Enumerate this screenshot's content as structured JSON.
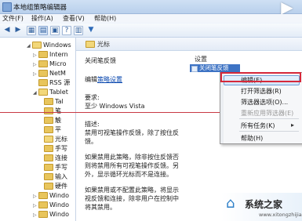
{
  "window": {
    "title": "本地组策略编辑器"
  },
  "menubar": {
    "items": [
      "文件(F)",
      "操作(A)",
      "查看(V)",
      "帮助(H)"
    ]
  },
  "tree": {
    "items": [
      {
        "label": "Windows",
        "indent": 0,
        "open": true
      },
      {
        "label": "Intern",
        "indent": 1
      },
      {
        "label": "Micro",
        "indent": 1
      },
      {
        "label": "NetM",
        "indent": 1
      },
      {
        "label": "RSS 源",
        "indent": 1
      },
      {
        "label": "Tablet",
        "indent": 1,
        "open": true
      },
      {
        "label": "Tal",
        "indent": 2
      },
      {
        "label": "笔",
        "indent": 2
      },
      {
        "label": "触",
        "indent": 2
      },
      {
        "label": "平",
        "indent": 2
      },
      {
        "label": "光标",
        "indent": 2
      },
      {
        "label": "手写",
        "indent": 2
      },
      {
        "label": "连接",
        "indent": 2
      },
      {
        "label": "手写",
        "indent": 2
      },
      {
        "label": "输入",
        "indent": 2
      },
      {
        "label": "硬件",
        "indent": 2
      },
      {
        "label": "Windo",
        "indent": 1
      },
      {
        "label": "Windo",
        "indent": 1
      },
      {
        "label": "Windo",
        "indent": 1
      }
    ]
  },
  "pane": {
    "header": "光标",
    "policy_title": "关闭笔反馈",
    "edit_prefix": "编辑",
    "edit_link": "策略设置",
    "requirements_label": "要求:",
    "requirements_value": "至少 Windows Vista",
    "description_label": "描述:",
    "description_1": "禁用可视笔操作反馈，除了按住反馈。",
    "description_2": "如果禁用此策略，除非按住反馈否则将禁用所有可视笔操作反馈。另外，显示循环光标而不是连接。",
    "description_3": "如果禁用或不配置此策略，将显示视反馈和连接，除非用户在控制中将其禁用。"
  },
  "list": {
    "header": "设置",
    "selected_row": "关闭笔反馈"
  },
  "context_menu": {
    "items": [
      "编辑(E)",
      "打开筛选器(R)",
      "筛选器选项(O)...",
      "重新应用筛选器(E)",
      "所有任务(K)",
      "帮助(H)"
    ]
  },
  "watermark": {
    "name": "系统之家",
    "url": "www.xitongzhijia.net"
  },
  "colors": {
    "highlight_border": "#d6283a",
    "selected_row": "#3d73c4"
  }
}
